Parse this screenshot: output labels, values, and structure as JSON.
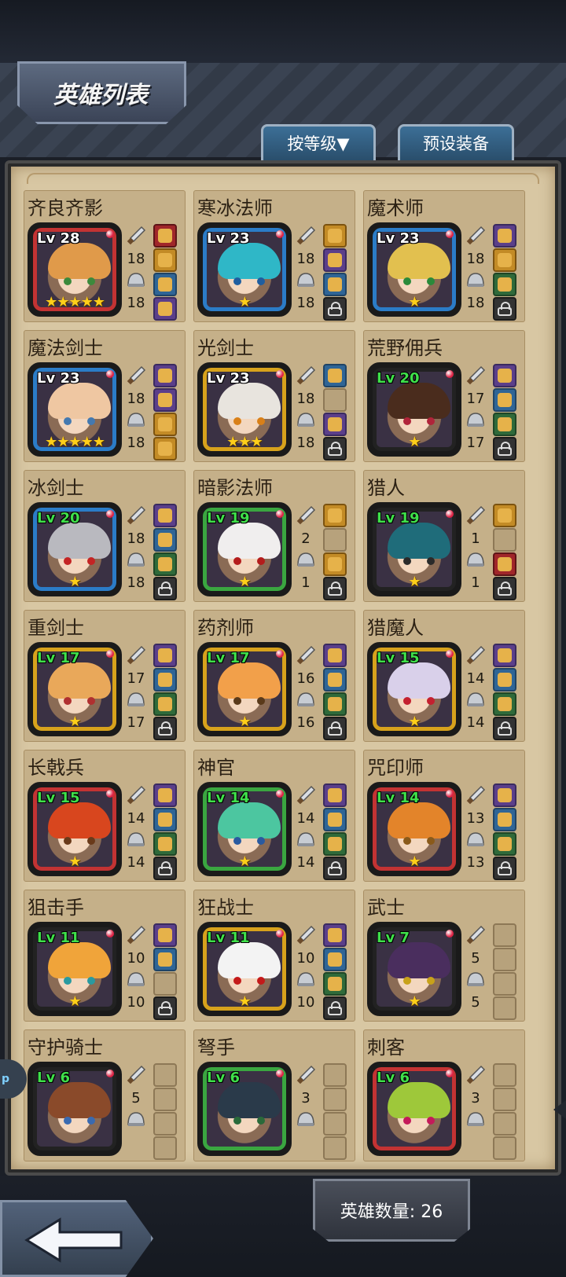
{
  "header": {
    "title": "英雄列表"
  },
  "tabs": {
    "sort_label": "按等级▼",
    "preset_label": "预设装备"
  },
  "footer": {
    "hero_count": "英雄数量: 26"
  },
  "side_tab_label": "p",
  "colors": {
    "frame_red": "#c33333",
    "frame_blue": "#2b7cc7",
    "frame_gold": "#d7a21c",
    "frame_green": "#3aa640",
    "frame_dark": "#222222",
    "parchment": "#d8c7a3",
    "level_green": "#3fe04a"
  },
  "heroes": [
    {
      "name": "齐良齐影",
      "level": "Lv 28",
      "level_color": "white",
      "frame": "red",
      "stars": "★★★★★",
      "attack": "18",
      "defense": "18",
      "slots": [
        "red",
        "gold",
        "blue",
        "purple"
      ],
      "hair": "#e09a4a",
      "eye": "#3c8a3c"
    },
    {
      "name": "寒冰法师",
      "level": "Lv 23",
      "level_color": "white",
      "frame": "blue",
      "stars": "★",
      "attack": "18",
      "defense": "18",
      "slots": [
        "gold",
        "purple",
        "blue",
        "lock"
      ],
      "hair": "#2fb7c7",
      "eye": "#1f5ea0"
    },
    {
      "name": "魔术师",
      "level": "Lv 23",
      "level_color": "white",
      "frame": "blue",
      "stars": "★",
      "attack": "18",
      "defense": "18",
      "slots": [
        "purple",
        "gold",
        "green",
        "lock"
      ],
      "hair": "#e2c04f",
      "eye": "#2a8a3a"
    },
    {
      "name": "魔法剑士",
      "level": "Lv 23",
      "level_color": "white",
      "frame": "blue",
      "stars": "★★★★★",
      "attack": "18",
      "defense": "18",
      "slots": [
        "purple",
        "purple",
        "gold",
        "gold"
      ],
      "hair": "#efc7a2",
      "eye": "#4479b0"
    },
    {
      "name": "光剑士",
      "level": "Lv 23",
      "level_color": "white",
      "frame": "gold",
      "stars": "★★★",
      "attack": "18",
      "defense": "18",
      "slots": [
        "blue",
        "empty",
        "purple",
        "lock"
      ],
      "hair": "#e8e4de",
      "eye": "#d98018"
    },
    {
      "name": "荒野佣兵",
      "level": "Lv 20",
      "level_color": "green",
      "frame": "dark",
      "stars": "★",
      "attack": "17",
      "defense": "17",
      "slots": [
        "purple",
        "blue",
        "green",
        "lock"
      ],
      "hair": "#4a2c1d",
      "eye": "#b0243a"
    },
    {
      "name": "冰剑士",
      "level": "Lv 20",
      "level_color": "green",
      "frame": "blue",
      "stars": "★",
      "attack": "18",
      "defense": "18",
      "slots": [
        "purple",
        "blue",
        "green",
        "lock"
      ],
      "hair": "#b9b9bf",
      "eye": "#c42424"
    },
    {
      "name": "暗影法师",
      "level": "Lv 19",
      "level_color": "green",
      "frame": "green",
      "stars": "★",
      "attack": "2",
      "defense": "1",
      "slots": [
        "gold",
        "empty",
        "gold",
        "lock"
      ],
      "hair": "#f0eeee",
      "eye": "#b41c1c"
    },
    {
      "name": "猎人",
      "level": "Lv 19",
      "level_color": "green",
      "frame": "dark",
      "stars": "★",
      "attack": "1",
      "defense": "1",
      "slots": [
        "gold",
        "empty",
        "red",
        "lock"
      ],
      "hair": "#1f6c7a",
      "eye": "#2a2a2a"
    },
    {
      "name": "重剑士",
      "level": "Lv 17",
      "level_color": "green",
      "frame": "gold",
      "stars": "★",
      "attack": "17",
      "defense": "17",
      "slots": [
        "purple",
        "blue",
        "green",
        "lock"
      ],
      "hair": "#e9a85a",
      "eye": "#b03030"
    },
    {
      "name": "药剂师",
      "level": "Lv 17",
      "level_color": "green",
      "frame": "gold",
      "stars": "★",
      "attack": "16",
      "defense": "16",
      "slots": [
        "purple",
        "blue",
        "green",
        "lock"
      ],
      "hair": "#f2a04a",
      "eye": "#5a3a1a"
    },
    {
      "name": "猎魔人",
      "level": "Lv 15",
      "level_color": "green",
      "frame": "gold",
      "stars": "★",
      "attack": "14",
      "defense": "14",
      "slots": [
        "purple",
        "blue",
        "green",
        "lock"
      ],
      "hair": "#d9d0ea",
      "eye": "#c42030"
    },
    {
      "name": "长戟兵",
      "level": "Lv 15",
      "level_color": "green",
      "frame": "red",
      "stars": "★",
      "attack": "14",
      "defense": "14",
      "slots": [
        "purple",
        "blue",
        "green",
        "lock"
      ],
      "hair": "#d8461e",
      "eye": "#6a3a1a"
    },
    {
      "name": "神官",
      "level": "Lv 14",
      "level_color": "green",
      "frame": "green",
      "stars": "★",
      "attack": "14",
      "defense": "14",
      "slots": [
        "purple",
        "blue",
        "green",
        "lock"
      ],
      "hair": "#4cc6a0",
      "eye": "#2a5aa0"
    },
    {
      "name": "咒印师",
      "level": "Lv 14",
      "level_color": "green",
      "frame": "red",
      "stars": "★",
      "attack": "13",
      "defense": "13",
      "slots": [
        "purple",
        "blue",
        "green",
        "lock"
      ],
      "hair": "#e3842a",
      "eye": "#8a5a1a"
    },
    {
      "name": "狙击手",
      "level": "Lv 11",
      "level_color": "green",
      "frame": "dark",
      "stars": "★",
      "attack": "10",
      "defense": "10",
      "slots": [
        "purple",
        "blue",
        "empty",
        "lock"
      ],
      "hair": "#f0a43a",
      "eye": "#2a9aa0"
    },
    {
      "name": "狂战士",
      "level": "Lv 11",
      "level_color": "green",
      "frame": "gold",
      "stars": "★",
      "attack": "10",
      "defense": "10",
      "slots": [
        "purple",
        "blue",
        "green",
        "lock"
      ],
      "hair": "#f3f3f3",
      "eye": "#c41a1a"
    },
    {
      "name": "武士",
      "level": "Lv 7",
      "level_color": "green",
      "frame": "dark",
      "stars": "★",
      "attack": "5",
      "defense": "5",
      "slots": [
        "empty",
        "empty",
        "empty",
        "empty"
      ],
      "hair": "#4a2e5e",
      "eye": "#c8a21a"
    },
    {
      "name": "守护骑士",
      "level": "Lv 6",
      "level_color": "green",
      "frame": "dark",
      "stars": "",
      "attack": "5",
      "defense": "",
      "slots": [
        "empty",
        "empty",
        "empty",
        "empty"
      ],
      "hair": "#8a4a2a",
      "eye": "#3a6ab0"
    },
    {
      "name": "弩手",
      "level": "Lv 6",
      "level_color": "green",
      "frame": "green",
      "stars": "",
      "attack": "3",
      "defense": "",
      "slots": [
        "empty",
        "empty",
        "empty",
        "empty"
      ],
      "hair": "#2a3a4a",
      "eye": "#2a6a3a"
    },
    {
      "name": "刺客",
      "level": "Lv 6",
      "level_color": "green",
      "frame": "red",
      "stars": "",
      "attack": "3",
      "defense": "",
      "slots": [
        "empty",
        "empty",
        "empty",
        "empty"
      ],
      "hair": "#9ec83a",
      "eye": "#c41a5a"
    }
  ]
}
